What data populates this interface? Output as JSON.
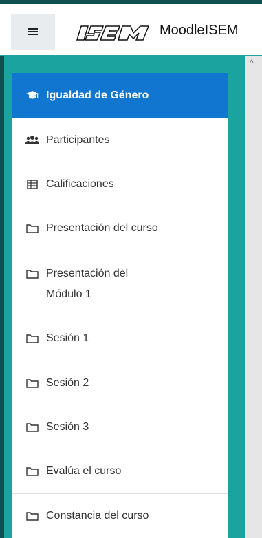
{
  "header": {
    "site_name": "MoodleISEM",
    "logo_text": "ISEM"
  },
  "nav": {
    "items": [
      {
        "label": "Igualdad de Género",
        "icon": "graduation-cap-icon",
        "active": true
      },
      {
        "label": "Participantes",
        "icon": "users-icon"
      },
      {
        "label": "Calificaciones",
        "icon": "table-icon"
      },
      {
        "label": "Presentación del curso",
        "icon": "folder-icon"
      },
      {
        "label": "Presentación del Módulo 1",
        "icon": "folder-icon"
      },
      {
        "label": "Sesión 1",
        "icon": "folder-icon"
      },
      {
        "label": "Sesión 2",
        "icon": "folder-icon"
      },
      {
        "label": "Sesión 3",
        "icon": "folder-icon"
      },
      {
        "label": "Evalúa el curso",
        "icon": "folder-icon"
      },
      {
        "label": "Constancia del curso",
        "icon": "folder-icon"
      }
    ]
  },
  "colors": {
    "accent": "#1176cf",
    "teal": "#1aa39f",
    "dark_teal": "#0f4f4f"
  }
}
